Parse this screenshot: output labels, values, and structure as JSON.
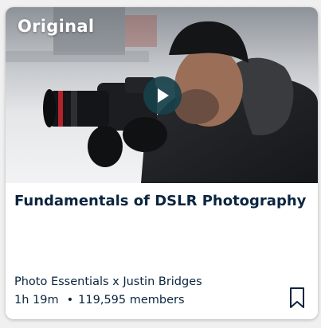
{
  "card": {
    "badge": "Original",
    "title": "Fundamentals of DSLR Photography",
    "provider": "Photo Essentials x Justin Bridges",
    "duration": "1h 19m",
    "separator": "•",
    "members": "119,595 members",
    "play_icon": "play-icon",
    "bookmark_icon": "bookmark-icon"
  },
  "colors": {
    "text": "#0b2540",
    "play_button": "#17404a",
    "card_bg": "#ffffff",
    "page_bg": "#f0f0f0"
  }
}
